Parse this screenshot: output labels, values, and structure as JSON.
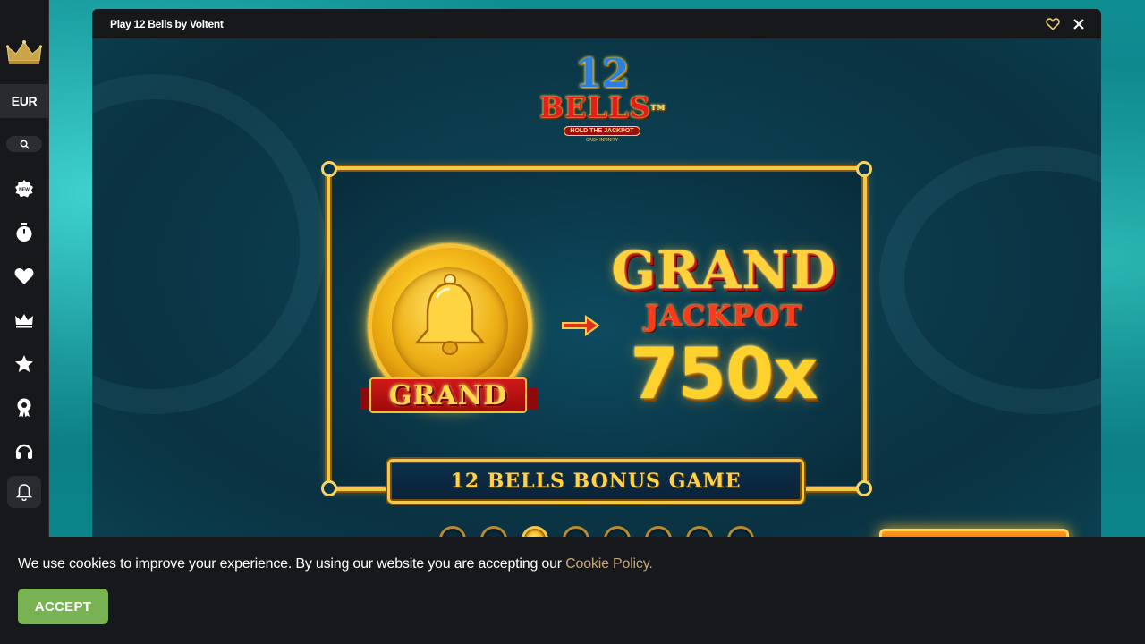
{
  "sidebar": {
    "currency": "EUR",
    "items": [
      {
        "icon": "new-badge-icon"
      },
      {
        "icon": "stopwatch-icon"
      },
      {
        "icon": "heart-icon"
      },
      {
        "icon": "crown-icon"
      },
      {
        "icon": "star-icon"
      },
      {
        "icon": "trophy-icon"
      },
      {
        "icon": "headset-icon"
      },
      {
        "icon": "bell-icon"
      }
    ]
  },
  "game_window": {
    "title": "Play 12 Bells by Voltent"
  },
  "game": {
    "logo_number": "12",
    "logo_name": "BELLS",
    "logo_tm": "TM",
    "logo_tagline": "HOLD THE JACKPOT",
    "logo_subtag": "CASH INFINITY",
    "medal_label": "GRAND",
    "jackpot_title": "GRAND",
    "jackpot_word": "JACKPOT",
    "jackpot_multiplier": "750x",
    "banner": "12 BELLS BONUS GAME",
    "pagination": {
      "total": 8,
      "active_index": 2
    }
  },
  "cookie": {
    "message": "We use cookies to improve your experience. By using our website you are accepting our ",
    "link_text": "Cookie Policy.",
    "accept_label": "ACCEPT"
  },
  "colors": {
    "accent_gold": "#ffd23c",
    "accept_green": "#79b253",
    "link_tan": "#c6a77a",
    "sidebar_bg": "#17181c"
  }
}
